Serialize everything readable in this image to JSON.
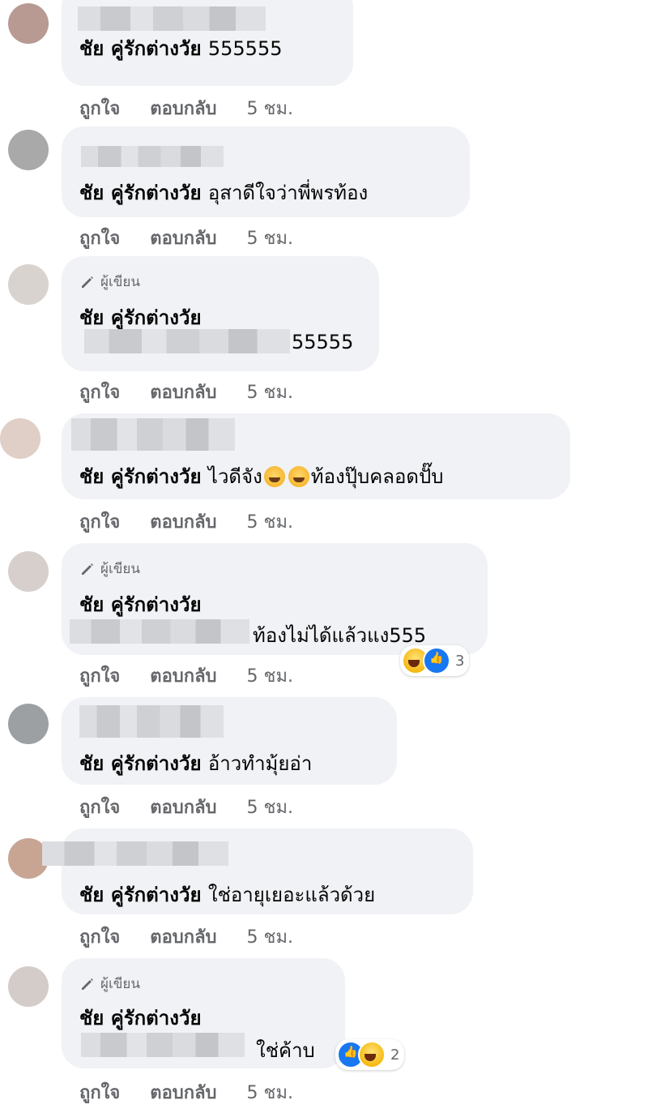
{
  "comments": [
    {
      "author_badge": "",
      "name": "ชัย คู่รักต่างวัย",
      "text": "555555",
      "line2": "",
      "like_label": "ถูกใจ",
      "reply_label": "ตอบกลับ",
      "time": "5 ชม."
    },
    {
      "author_badge": "",
      "name": "ชัย คู่รักต่างวัย",
      "text": "อุสาดีใจว่าพี่พรท้อง",
      "line2": "",
      "like_label": "ถูกใจ",
      "reply_label": "ตอบกลับ",
      "time": "5 ชม."
    },
    {
      "author_badge": "ผู้เขียน",
      "name": "ชัย คู่รักต่างวัย",
      "text": "",
      "line2": "55555",
      "like_label": "ถูกใจ",
      "reply_label": "ตอบกลับ",
      "time": "5 ชม."
    },
    {
      "author_badge": "",
      "name": "ชัย คู่รักต่างวัย",
      "text": "ไวดีจัง",
      "text_after_emoji": "ท้องปุ๊บคลอดปั๊บ",
      "line2": "",
      "like_label": "ถูกใจ",
      "reply_label": "ตอบกลับ",
      "time": "5 ชม."
    },
    {
      "author_badge": "ผู้เขียน",
      "name": "ชัย คู่รักต่างวัย",
      "text": "",
      "line2": "ท้องไม่ได้แล้วแง555",
      "reaction_count": "3",
      "like_label": "ถูกใจ",
      "reply_label": "ตอบกลับ",
      "time": "5 ชม."
    },
    {
      "author_badge": "",
      "name": "ชัย คู่รักต่างวัย",
      "text": "อ้าวทำมุ้ยอ่า",
      "line2": "",
      "like_label": "ถูกใจ",
      "reply_label": "ตอบกลับ",
      "time": "5 ชม."
    },
    {
      "author_badge": "",
      "name": "ชัย คู่รักต่างวัย",
      "text": "ใช่อายุเยอะแล้วด้วย",
      "line2": "",
      "like_label": "ถูกใจ",
      "reply_label": "ตอบกลับ",
      "time": "5 ชม."
    },
    {
      "author_badge": "ผู้เขียน",
      "name": "ชัย คู่รักต่างวัย",
      "text": "",
      "line2": "ใช่ค้าบ",
      "reaction_count": "2",
      "like_label": "ถูกใจ",
      "reply_label": "ตอบกลับ",
      "time": "5 ชม."
    }
  ],
  "icons": {
    "badge": "pencil-icon",
    "emoji": "grinning-emoji-icon",
    "reactions": [
      "haha-reaction-icon",
      "like-reaction-icon"
    ]
  },
  "colors": {
    "bubble": "#f0f2f5",
    "meta_text": "#65676b",
    "name_text": "#050505",
    "like_blue": "#1877f2"
  }
}
